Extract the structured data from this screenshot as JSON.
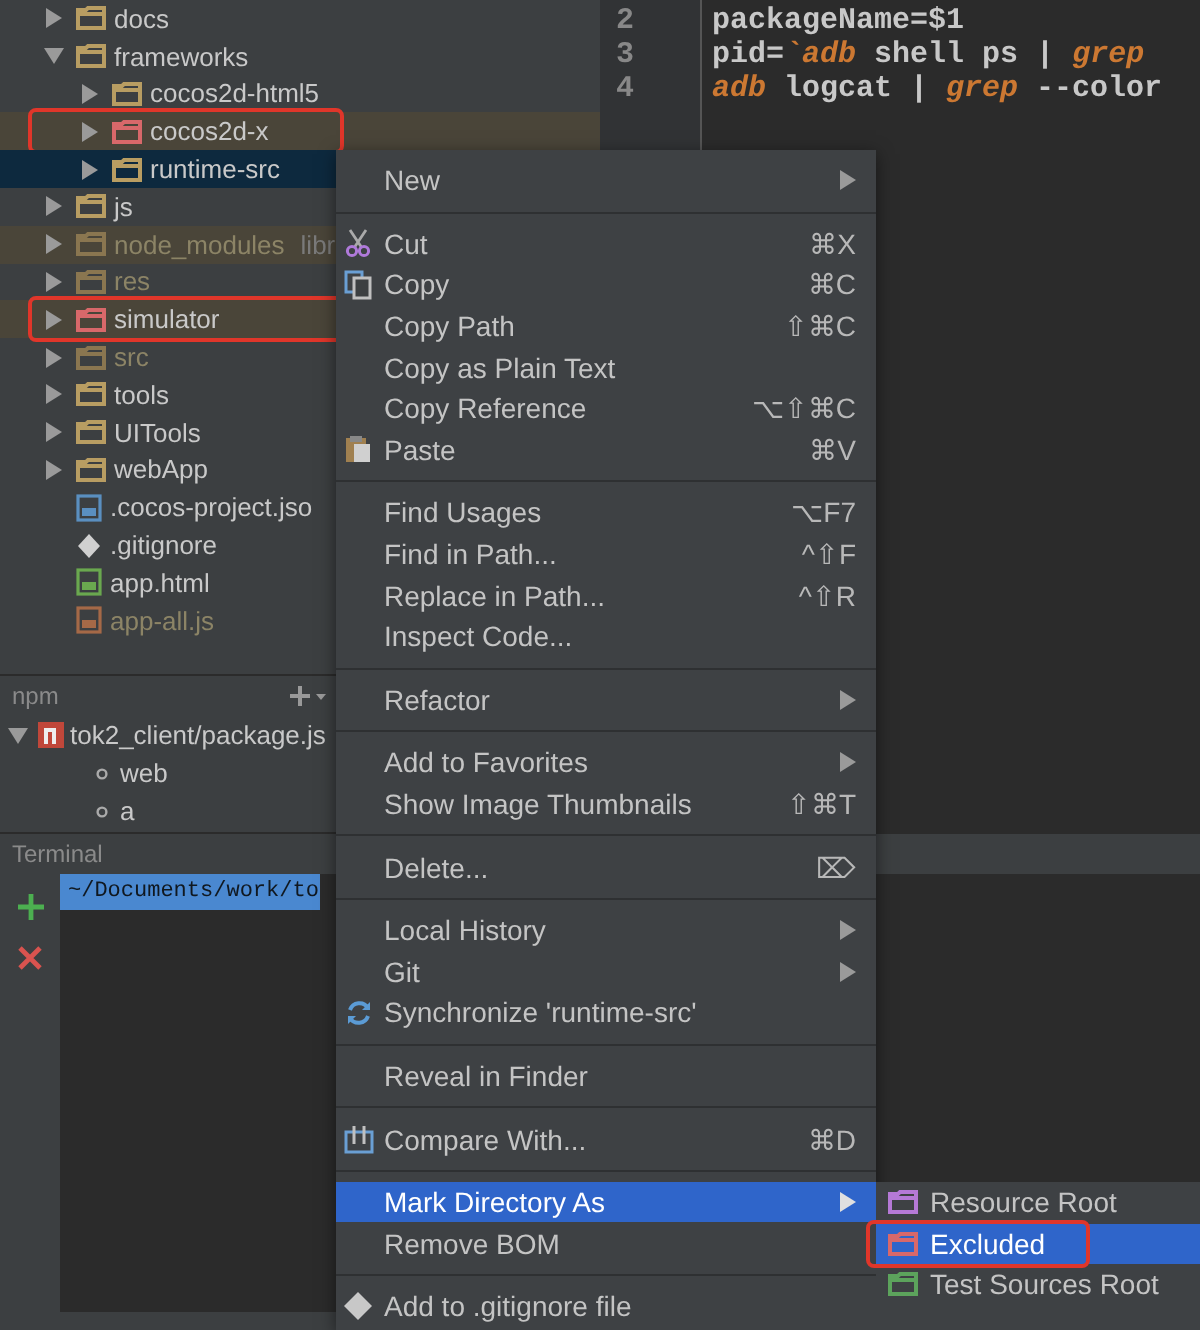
{
  "project_tree": [
    {
      "label": "docs",
      "kind": "folder",
      "expanded": false,
      "excluded": false,
      "ignored": false,
      "highlighted": false,
      "selected": false,
      "annotated": false
    },
    {
      "label": "frameworks",
      "kind": "folder",
      "expanded": true,
      "excluded": false,
      "ignored": false,
      "highlighted": false,
      "selected": false,
      "annotated": false,
      "children": [
        {
          "label": "cocos2d-html5",
          "kind": "folder",
          "expanded": false,
          "excluded": false,
          "ignored": false,
          "highlighted": false,
          "selected": false,
          "annotated": false
        },
        {
          "label": "cocos2d-x",
          "kind": "folder",
          "expanded": false,
          "excluded": true,
          "ignored": false,
          "highlighted": true,
          "selected": false,
          "annotated": true
        },
        {
          "label": "runtime-src",
          "kind": "folder",
          "expanded": false,
          "excluded": false,
          "ignored": false,
          "highlighted": false,
          "selected": true,
          "annotated": false
        }
      ]
    },
    {
      "label": "js",
      "kind": "folder",
      "expanded": false,
      "excluded": false,
      "ignored": false,
      "highlighted": false,
      "selected": false,
      "annotated": false
    },
    {
      "label": "node_modules",
      "suffix": "libr",
      "kind": "folder",
      "expanded": false,
      "excluded": false,
      "ignored": true,
      "highlighted": true,
      "selected": false,
      "annotated": false
    },
    {
      "label": "res",
      "kind": "folder",
      "expanded": false,
      "excluded": false,
      "ignored": true,
      "highlighted": false,
      "selected": false,
      "annotated": false
    },
    {
      "label": "simulator",
      "kind": "folder",
      "expanded": false,
      "excluded": true,
      "ignored": false,
      "highlighted": true,
      "selected": false,
      "annotated": true
    },
    {
      "label": "src",
      "kind": "folder",
      "expanded": false,
      "excluded": false,
      "ignored": true,
      "highlighted": false,
      "selected": false,
      "annotated": false
    },
    {
      "label": "tools",
      "kind": "folder",
      "expanded": false,
      "excluded": false,
      "ignored": false,
      "highlighted": false,
      "selected": false,
      "annotated": false
    },
    {
      "label": "UITools",
      "kind": "folder",
      "expanded": false,
      "excluded": false,
      "ignored": false,
      "highlighted": false,
      "selected": false,
      "annotated": false
    },
    {
      "label": "webApp",
      "kind": "folder",
      "expanded": false,
      "excluded": false,
      "ignored": false,
      "highlighted": false,
      "selected": false,
      "annotated": false
    },
    {
      "label": ".cocos-project.jso",
      "kind": "json",
      "ignored": false,
      "highlighted": false,
      "selected": false,
      "annotated": false
    },
    {
      "label": ".gitignore",
      "kind": "git",
      "ignored": false,
      "highlighted": false,
      "selected": false,
      "annotated": false
    },
    {
      "label": "app.html",
      "kind": "html",
      "ignored": false,
      "highlighted": false,
      "selected": false,
      "annotated": false
    },
    {
      "label": "app-all.js",
      "kind": "js",
      "ignored": true,
      "highlighted": false,
      "selected": false,
      "annotated": false
    }
  ],
  "editor": {
    "lines": [
      {
        "number": "2",
        "tokens": [
          {
            "kind": "plain",
            "text": "packageName=$1"
          }
        ]
      },
      {
        "number": "3",
        "tokens": [
          {
            "kind": "plain",
            "text": "pid="
          },
          {
            "kind": "keyword",
            "text": "`adb"
          },
          {
            "kind": "plain",
            "text": " shell ps | "
          },
          {
            "kind": "keyword",
            "text": "grep"
          }
        ]
      },
      {
        "number": "4",
        "tokens": [
          {
            "kind": "keyword",
            "text": "adb"
          },
          {
            "kind": "plain",
            "text": " logcat | "
          },
          {
            "kind": "keyword",
            "text": "grep"
          },
          {
            "kind": "plain",
            "text": " --color"
          }
        ]
      }
    ]
  },
  "npm": {
    "title": "npm",
    "scripts": {
      "label": "tok2_client/package.js",
      "expanded": true,
      "children": [
        "web",
        "a"
      ]
    }
  },
  "terminal": {
    "title": "Terminal",
    "tab": "~/Documents/work/to"
  },
  "context_menu": {
    "groups": [
      [
        {
          "label": "New",
          "submenu": true,
          "selected": false
        }
      ],
      [
        {
          "label": "Cut",
          "kind": "cut",
          "shortcut": "⌘X",
          "selected": false
        },
        {
          "label": "Copy",
          "kind": "copy",
          "shortcut": "⌘C",
          "selected": false
        },
        {
          "label": "Copy Path",
          "shortcut": "⇧⌘C",
          "selected": false
        },
        {
          "label": "Copy as Plain Text",
          "selected": false
        },
        {
          "label": "Copy Reference",
          "shortcut": "⌥⇧⌘C",
          "selected": false
        },
        {
          "label": "Paste",
          "kind": "paste",
          "shortcut": "⌘V",
          "selected": false
        }
      ],
      [
        {
          "label": "Find Usages",
          "shortcut": "⌥F7",
          "selected": false
        },
        {
          "label": "Find in Path...",
          "shortcut": "^⇧F",
          "selected": false
        },
        {
          "label": "Replace in Path...",
          "shortcut": "^⇧R",
          "selected": false
        },
        {
          "label": "Inspect Code...",
          "selected": false
        }
      ],
      [
        {
          "label": "Refactor",
          "submenu": true,
          "selected": false
        }
      ],
      [
        {
          "label": "Add to Favorites",
          "submenu": true,
          "selected": false
        },
        {
          "label": "Show Image Thumbnails",
          "shortcut": "⇧⌘T",
          "selected": false
        }
      ],
      [
        {
          "label": "Delete...",
          "shortcut": "⌦",
          "selected": false
        }
      ],
      [
        {
          "label": "Local History",
          "submenu": true,
          "selected": false
        },
        {
          "label": "Git",
          "submenu": true,
          "selected": false
        },
        {
          "label": "Synchronize 'runtime-src'",
          "kind": "sync",
          "selected": false
        }
      ],
      [
        {
          "label": "Reveal in Finder",
          "selected": false
        }
      ],
      [
        {
          "label": "Compare With...",
          "kind": "compare",
          "shortcut": "⌘D",
          "selected": false
        }
      ],
      [
        {
          "label": "Mark Directory As",
          "submenu": true,
          "selected": true
        },
        {
          "label": "Remove BOM",
          "selected": false
        }
      ],
      [
        {
          "label": "Add to .gitignore file",
          "kind": "gitignore",
          "selected": false
        }
      ]
    ]
  },
  "submenu": {
    "items": [
      {
        "label": "Resource Root",
        "kind": "resource",
        "selected": false,
        "annotated": false
      },
      {
        "label": "Excluded",
        "kind": "excluded",
        "selected": true,
        "annotated": true
      },
      {
        "label": "Test Sources Root",
        "kind": "test",
        "selected": false,
        "annotated": false
      }
    ]
  }
}
